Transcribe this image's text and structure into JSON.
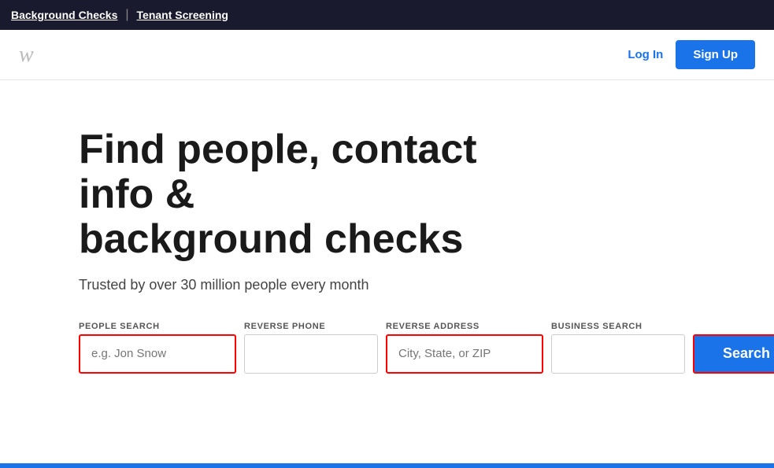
{
  "topbar": {
    "link1": "Background Checks",
    "divider": "|",
    "link2": "Tenant Screening"
  },
  "header": {
    "logo": "w",
    "login_label": "Log In",
    "signup_label": "Sign Up"
  },
  "main": {
    "headline_line1": "Find people, contact info &",
    "headline_line2": "background checks",
    "subheadline": "Trusted by over 30 million people every month",
    "tabs": [
      {
        "label": "PEOPLE SEARCH"
      },
      {
        "label": "REVERSE PHONE"
      },
      {
        "label": "REVERSE ADDRESS"
      },
      {
        "label": "BUSINESS SEARCH"
      }
    ],
    "name_placeholder": "e.g. Jon Snow",
    "address_placeholder": "City, State, or ZIP",
    "search_button_label": "Search"
  }
}
